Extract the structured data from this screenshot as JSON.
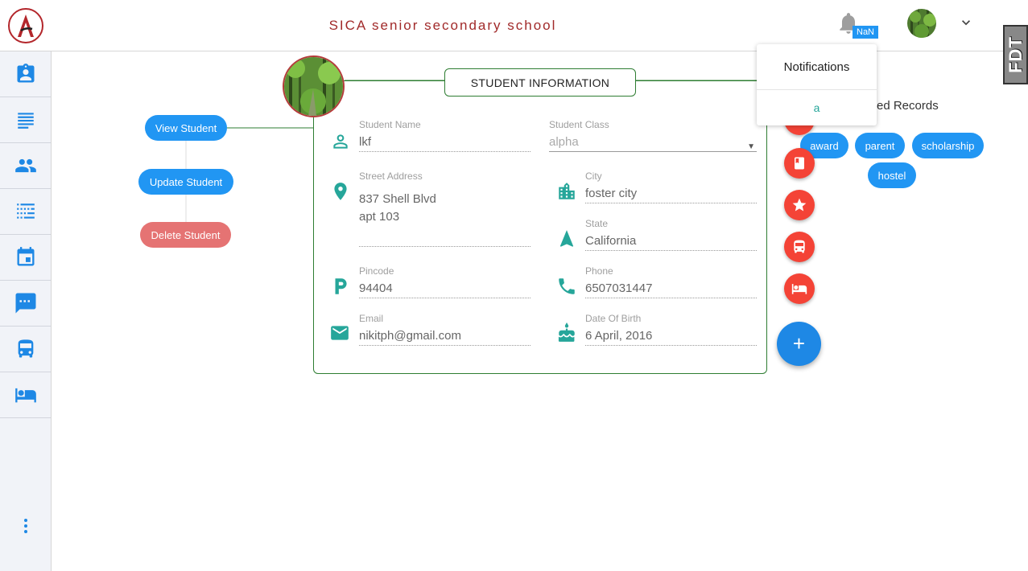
{
  "header": {
    "school_name": "SICA senior secondary school",
    "notification_badge": "NaN",
    "side_tab_label": "FDT"
  },
  "sidebar": {
    "items": [
      {
        "icon": "id-badge-icon"
      },
      {
        "icon": "list-lines-icon"
      },
      {
        "icon": "people-icon"
      },
      {
        "icon": "grid-list-icon"
      },
      {
        "icon": "calendar-icon"
      },
      {
        "icon": "chat-icon"
      },
      {
        "icon": "bus-icon"
      },
      {
        "icon": "bed-icon"
      }
    ]
  },
  "actions": {
    "view": "View Student",
    "update": "Update Student",
    "delete": "Delete Student"
  },
  "card": {
    "title": "STUDENT INFORMATION",
    "fields": {
      "name": {
        "label": "Student Name",
        "value": "lkf"
      },
      "class": {
        "label": "Student Class",
        "value": "alpha"
      },
      "address": {
        "label": "Street Address",
        "line1": "837 Shell Blvd",
        "line2": "apt 103"
      },
      "city": {
        "label": "City",
        "value": "foster city"
      },
      "state": {
        "label": "State",
        "value": "California"
      },
      "pincode": {
        "label": "Pincode",
        "value": "94404"
      },
      "phone": {
        "label": "Phone",
        "value": "6507031447"
      },
      "email": {
        "label": "Email",
        "value": "nikitph@gmail.com"
      },
      "dob": {
        "label": "Date Of Birth",
        "value": "6 April, 2016"
      }
    }
  },
  "notifications": {
    "title": "Notifications",
    "items": [
      "a"
    ]
  },
  "related": {
    "title_visible": "ed Records",
    "chips": [
      "award",
      "parent",
      "scholarship",
      "hostel"
    ],
    "fab_plus": "+"
  },
  "colors": {
    "primary": "#2196f3",
    "danger": "#e57373",
    "fab_red": "#f44336",
    "accent_teal": "#26a69a",
    "card_border": "#2e7d32",
    "school_name": "#a12a2a"
  }
}
